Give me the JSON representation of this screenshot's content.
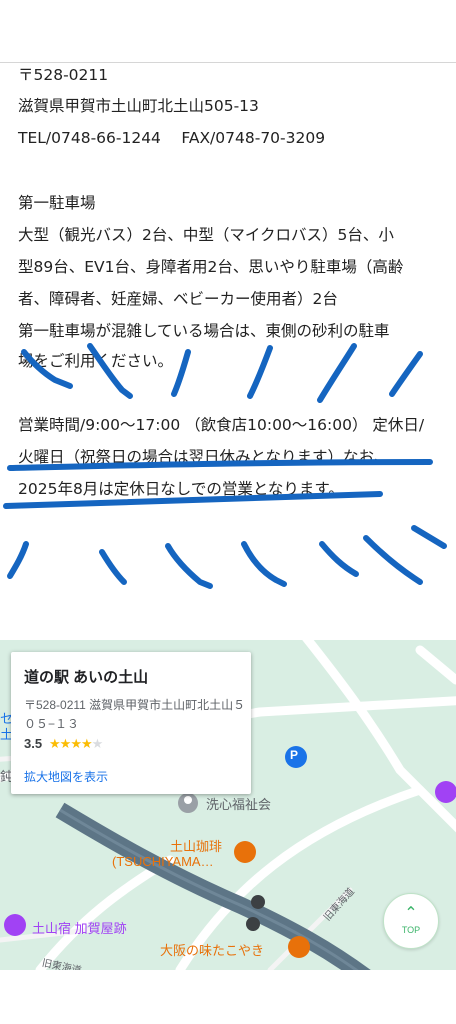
{
  "address": {
    "postal": "〒528-0211",
    "street": "滋賀県甲賀市土山町北土山505-13",
    "tel_fax": "TEL/0748-66-1244　 FAX/0748-70-3209"
  },
  "parking": {
    "heading": "第一駐車場",
    "line1": "大型（観光バス）2台、中型（マイクロバス）5台、小",
    "line2": "型89台、EV1台、身障者用2台、思いやり駐車場（高齢",
    "line3": "者、障碍者、妊産婦、ベビーカー使用者）2台",
    "line4": "第一駐車場が混雑している場合は、東側の砂利の駐車",
    "line5": "場をご利用ください。"
  },
  "hours": {
    "line1": "営業時間/9:00～17:00 （飲食店10:00～16:00） 定休日/",
    "line2": "火曜日（祝祭日の場合は翌日休みとなります）なお、",
    "line3": "2025年8月は定休日なしでの営業となります。"
  },
  "map": {
    "card": {
      "title": "道の駅 あいの土山",
      "address": "〒528-0211 滋賀県甲賀市土山町北土山５０５−１３",
      "rating": "3.5",
      "rating_value": 3.5,
      "link": "拡大地図を表示"
    },
    "poi": {
      "parking": "P",
      "welfare": "洗心福祉会",
      "cafe_name": "土山珈琲",
      "cafe_sub": "(TSUCHIYAMA…",
      "shukuba": "土山宿 加賀屋跡",
      "takoyaki": "大阪の味たこやき",
      "road1": "旧東海道",
      "road2": "旧東海道",
      "edge_left1": "セ",
      "edge_left2": "土",
      "edge_left3": "鈍"
    },
    "top_button": "TOP"
  },
  "colors": {
    "annotation": "#1565c0",
    "map_bg": "#d9eee3",
    "road": "#5d7586",
    "link": "#1a73e8",
    "poi_orange": "#e8710a",
    "poi_purple": "#a142f4"
  }
}
